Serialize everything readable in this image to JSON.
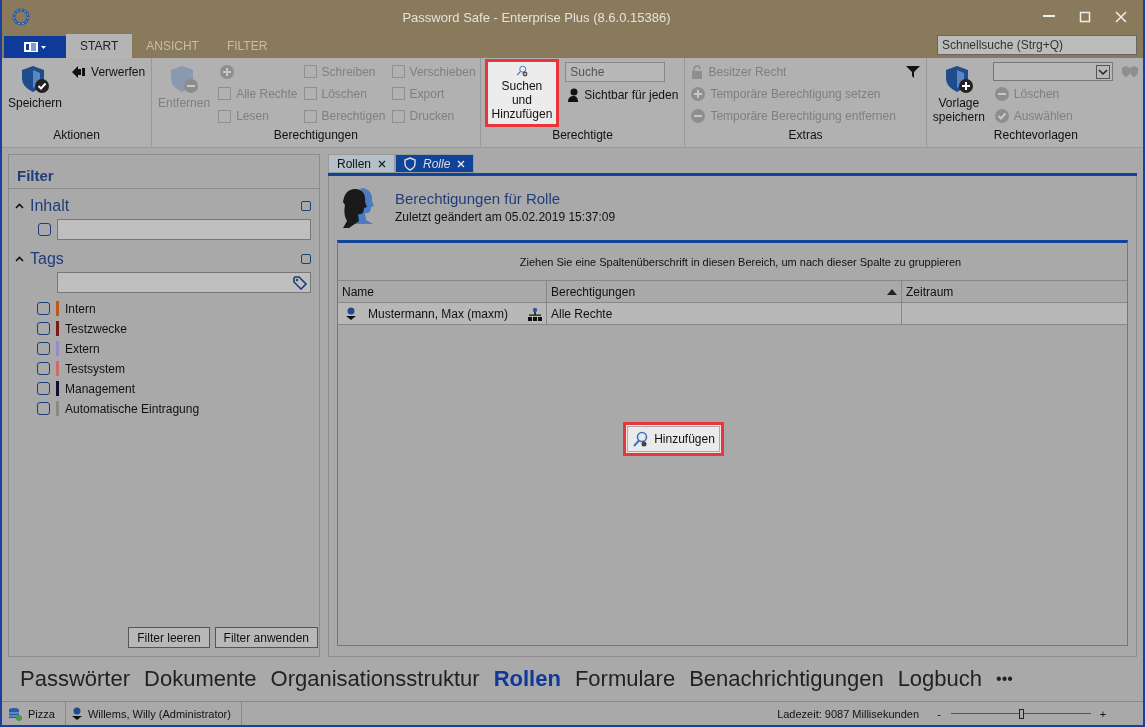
{
  "window": {
    "title": "Password Safe - Enterprise Plus (8.6.0.15386)"
  },
  "ribbon_tabs": [
    {
      "label": "START",
      "selected": true
    },
    {
      "label": "ANSICHT",
      "selected": false
    },
    {
      "label": "FILTER",
      "selected": false
    }
  ],
  "quick_search": {
    "placeholder": "Schnellsuche (Strg+Q)"
  },
  "ribbon_groups": [
    {
      "label": "Aktionen",
      "columns": [
        [
          {
            "kind": "large",
            "label": "Speichern",
            "disabled": false
          }
        ],
        [
          {
            "kind": "small",
            "label": "Verwerfen",
            "disabled": false
          }
        ]
      ]
    },
    {
      "label": "Berechtigungen",
      "columns": [
        [
          {
            "kind": "large",
            "label": "Entfernen",
            "disabled": true
          }
        ],
        [
          {
            "kind": "iconbtn",
            "disabled": true
          },
          {
            "kind": "check",
            "label": "Alle Rechte",
            "checked": false,
            "disabled": true
          },
          {
            "kind": "check",
            "label": "Lesen",
            "checked": false,
            "disabled": true
          }
        ],
        [
          {
            "kind": "check",
            "label": "Schreiben",
            "checked": false,
            "disabled": true
          },
          {
            "kind": "check",
            "label": "Löschen",
            "checked": false,
            "disabled": true
          },
          {
            "kind": "check",
            "label": "Berechtigen",
            "checked": false,
            "disabled": true
          }
        ],
        [
          {
            "kind": "check",
            "label": "Verschieben",
            "checked": false,
            "disabled": true
          },
          {
            "kind": "check",
            "label": "Export",
            "checked": false,
            "disabled": true
          },
          {
            "kind": "check",
            "label": "Drucken",
            "checked": false,
            "disabled": true
          }
        ]
      ]
    },
    {
      "label": "Berechtigte",
      "columns": [
        [
          {
            "kind": "large",
            "label": "Suchen und Hinzufügen",
            "disabled": false,
            "highlighted": true
          }
        ],
        [
          {
            "kind": "field",
            "placeholder": "Suche"
          },
          {
            "kind": "small",
            "label": "Sichtbar für jeden",
            "disabled": false
          }
        ]
      ]
    },
    {
      "label": "Extras",
      "columns": [
        [
          {
            "kind": "small",
            "label": "Besitzer Recht",
            "disabled": true
          },
          {
            "kind": "small",
            "label": "Temporäre Berechtigung setzen",
            "disabled": true
          },
          {
            "kind": "small",
            "label": "Temporäre Berechtigung entfernen",
            "disabled": true
          }
        ],
        [
          {
            "kind": "iconbtn"
          }
        ]
      ]
    },
    {
      "label": "Rechtevorlagen",
      "columns": [
        [
          {
            "kind": "large",
            "label": "Vorlage speichern",
            "disabled": false
          }
        ],
        [
          {
            "kind": "combo"
          },
          {
            "kind": "small",
            "label": "Löschen",
            "disabled": true
          },
          {
            "kind": "small",
            "label": "Auswählen",
            "disabled": true
          }
        ],
        [
          {
            "kind": "iconbtn",
            "disabled": true
          }
        ]
      ]
    }
  ],
  "filter_panel": {
    "title": "Filter",
    "sections": [
      {
        "label": "Inhalt",
        "expanded": true,
        "checked": false
      },
      {
        "label": "Tags",
        "expanded": true,
        "checked": false
      }
    ],
    "content_filter": {
      "checked": false
    },
    "tags": [
      {
        "label": "Intern",
        "color": "#c0581c",
        "checked": false
      },
      {
        "label": "Testzwecke",
        "color": "#7a1a10",
        "checked": false
      },
      {
        "label": "Extern",
        "color": "#9a88c8",
        "checked": false
      },
      {
        "label": "Testsystem",
        "color": "#d06a6a",
        "checked": false
      },
      {
        "label": "Management",
        "color": "#101030",
        "checked": false
      },
      {
        "label": "Automatische Eintragung",
        "color": "#8a8a84",
        "checked": false
      }
    ],
    "buttons": [
      "Filter leeren",
      "Filter anwenden"
    ]
  },
  "doc_tabs": [
    {
      "label": "Rollen",
      "selected": false
    },
    {
      "label": "Rolle",
      "selected": true
    }
  ],
  "header": {
    "title": "Berechtigungen für Rolle",
    "subtitle": "Zuletzt geändert am 05.02.2019 15:37:09"
  },
  "table": {
    "group_hint": "Ziehen Sie eine Spaltenüberschrift in diesen Bereich, um nach dieser Spalte zu gruppieren",
    "columns": [
      {
        "label": "Name",
        "sorted": false
      },
      {
        "label": "Berechtigungen",
        "sorted": true
      },
      {
        "label": "Zeitraum",
        "sorted": false
      }
    ],
    "rows": [
      {
        "cells": [
          "Mustermann, Max (maxm)",
          "Alle Rechte",
          ""
        ]
      }
    ]
  },
  "add_button": {
    "label": "Hinzufügen",
    "highlighted": true
  },
  "nav": [
    {
      "label": "Passwörter",
      "selected": false
    },
    {
      "label": "Dokumente",
      "selected": false
    },
    {
      "label": "Organisationsstruktur",
      "selected": false
    },
    {
      "label": "Rollen",
      "selected": true
    },
    {
      "label": "Formulare",
      "selected": false
    },
    {
      "label": "Benachrichtigungen",
      "selected": false
    },
    {
      "label": "Logbuch",
      "selected": false
    }
  ],
  "nav_more": "•••",
  "status_bar": {
    "database": "Pizza",
    "user": "Willems, Willy (Administrator)",
    "load_time": "Ladezeit: 9087 Millisekunden",
    "zoom_minus": "-",
    "zoom_plus": "+",
    "zoom": {
      "level": 0.5
    }
  }
}
